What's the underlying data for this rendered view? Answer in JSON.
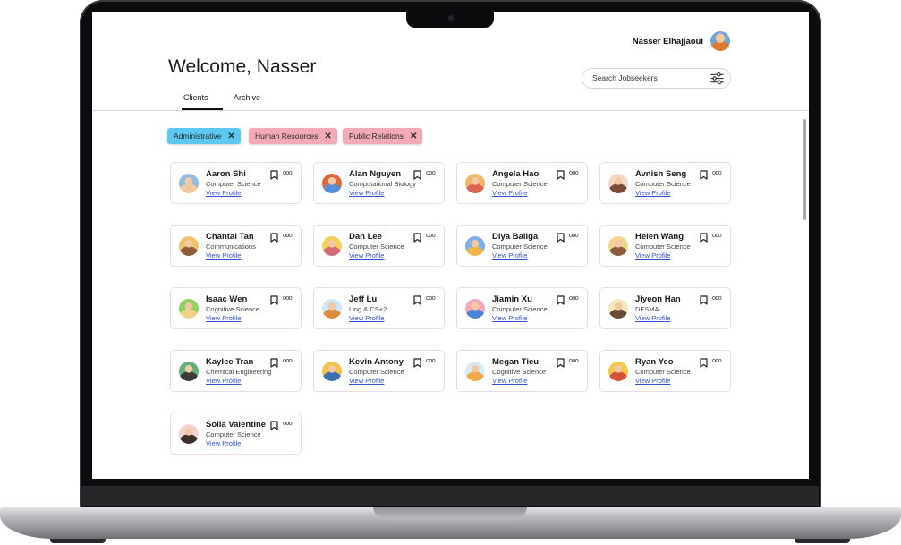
{
  "user": {
    "name": "Nasser Elhajjaoui",
    "avatar_icon": "user-avatar"
  },
  "page": {
    "title": "Welcome, Nasser"
  },
  "search": {
    "placeholder": "Search Jobseekers",
    "filter_icon": "sliders-icon"
  },
  "tabs": [
    {
      "label": "Clients",
      "active": true
    },
    {
      "label": "Archive",
      "active": false
    }
  ],
  "filters": [
    {
      "label": "Administrative",
      "color": "#5cc8ef",
      "remove": "✕"
    },
    {
      "label": "Human Resources",
      "color": "#f2aab8",
      "remove": "✕"
    },
    {
      "label": "Public Relations",
      "color": "#f2aab8",
      "remove": "✕"
    }
  ],
  "clients": [
    {
      "name": "Aaron Shi",
      "major": "Computer Science",
      "link": "View Profile",
      "avatar_colors": [
        "#8fbce8",
        "#f0c9a0"
      ]
    },
    {
      "name": "Alan Nguyen",
      "major": "Computational Biology",
      "link": "View Profile",
      "avatar_colors": [
        "#e0673c",
        "#5a8fd6"
      ]
    },
    {
      "name": "Angela Hao",
      "major": "Computer Science",
      "link": "View Profile",
      "avatar_colors": [
        "#f4b66a",
        "#d96552"
      ]
    },
    {
      "name": "Avnish Seng",
      "major": "Computer Science",
      "link": "View Profile",
      "avatar_colors": [
        "#f1d8c8",
        "#7a4a3a"
      ]
    },
    {
      "name": "Chantal Tan",
      "major": "Communications",
      "link": "View Profile",
      "avatar_colors": [
        "#f3c26d",
        "#8c5c3a"
      ]
    },
    {
      "name": "Dan Lee",
      "major": "Computer Science",
      "link": "View Profile",
      "avatar_colors": [
        "#f2cf5b",
        "#d26b7a"
      ]
    },
    {
      "name": "Diya Baliga",
      "major": "Computer Science",
      "link": "View Profile",
      "avatar_colors": [
        "#7db0e8",
        "#f0b54a"
      ]
    },
    {
      "name": "Helen Wang",
      "major": "Computer Science",
      "link": "View Profile",
      "avatar_colors": [
        "#f2d48f",
        "#8a5b3c"
      ]
    },
    {
      "name": "Isaac Wen",
      "major": "Cognitive Science",
      "link": "View Profile",
      "avatar_colors": [
        "#8fd25b",
        "#f0d28a"
      ]
    },
    {
      "name": "Jeff Lu",
      "major": "Ling & CS+2",
      "link": "View Profile",
      "avatar_colors": [
        "#cfe6f7",
        "#e08a3c"
      ]
    },
    {
      "name": "Jiamin Xu",
      "major": "Computer Science",
      "link": "View Profile",
      "avatar_colors": [
        "#f2a8bf",
        "#4f7fd6"
      ]
    },
    {
      "name": "Jiyeon Han",
      "major": "DESMA",
      "link": "View Profile",
      "avatar_colors": [
        "#f3e7c0",
        "#6a4b3a"
      ]
    },
    {
      "name": "Kaylee Tran",
      "major": "Chemical Engineering",
      "link": "View Profile",
      "avatar_colors": [
        "#5db07a",
        "#3e3a38"
      ]
    },
    {
      "name": "Kevin Antony",
      "major": "Computer Science",
      "link": "View Profile",
      "avatar_colors": [
        "#f2c14b",
        "#3f6fb3"
      ]
    },
    {
      "name": "Megan Tieu",
      "major": "Cognitive Science",
      "link": "View Profile",
      "avatar_colors": [
        "#d8e9f7",
        "#f0a84a"
      ]
    },
    {
      "name": "Ryan Yeo",
      "major": "Computer Science",
      "link": "View Profile",
      "avatar_colors": [
        "#f3c64c",
        "#d4523a"
      ]
    },
    {
      "name": "Solia Valentine",
      "major": "Computer Science",
      "link": "View Profile",
      "avatar_colors": [
        "#f5d2d2",
        "#3f2f2a"
      ]
    }
  ],
  "card_icons": {
    "bookmark": "bookmark-icon",
    "more": "ooo"
  }
}
